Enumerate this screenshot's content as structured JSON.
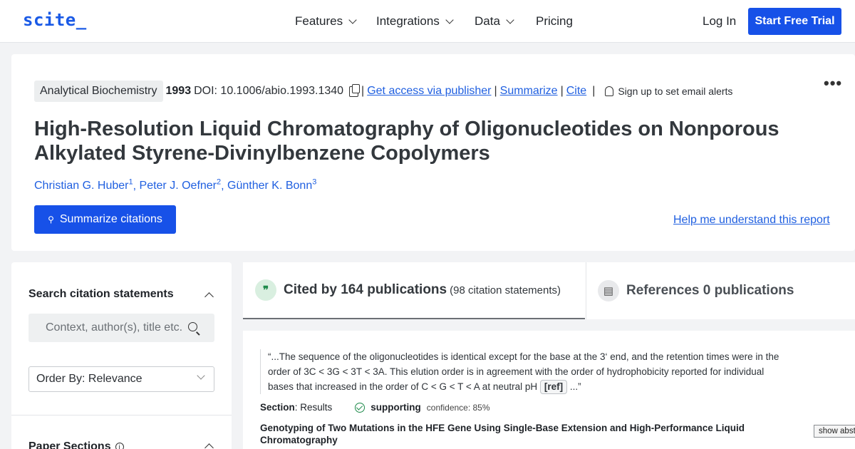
{
  "nav": {
    "logo": "scite_",
    "items": [
      {
        "label": "Features",
        "dropdown": true
      },
      {
        "label": "Integrations",
        "dropdown": true
      },
      {
        "label": "Data",
        "dropdown": true
      },
      {
        "label": "Pricing",
        "dropdown": false
      }
    ],
    "login": "Log In",
    "trial": "Start Free Trial"
  },
  "paper": {
    "journal": "Analytical Biochemistry",
    "year": "1993",
    "doi": "DOI: 10.1006/abio.1993.1340",
    "links": {
      "access": "Get access via publisher",
      "summarize": "Summarize",
      "cite": "Cite"
    },
    "alerts": "Sign up to set email alerts",
    "title": "High-Resolution Liquid Chromatography of Oligonucleotides on Nonporous Alkylated Styrene-Divinylbenzene Copolymers",
    "authors": [
      {
        "name": "Christian G. Huber",
        "sup": "1"
      },
      {
        "name": "Peter J. Oefner",
        "sup": "2"
      },
      {
        "name": "Günther K. Bonn",
        "sup": "3"
      }
    ],
    "summarize_button": "Summarize citations",
    "help_link": "Help me understand this report"
  },
  "sidebar": {
    "search_title": "Search citation statements",
    "search_placeholder": "Context, author(s), title etc.",
    "order_by": "Order By: Relevance",
    "sections_title": "Paper Sections"
  },
  "tabs": {
    "cited_main": "Cited by 164 publications",
    "cited_sub": "(98 citation statements)",
    "refs_main": "References 0 publications"
  },
  "result": {
    "quote_before": "“...The sequence of the oligonucleotides is identical except for the base at the 3‘ end, and the retention times were in the order of 3C < 3G < 3T < 3A. This elution order is in agreement with the order of hydrophobicity reported for individual bases that increased in the order of C < G < T < A at neutral pH ",
    "ref_tag": "[ref]",
    "quote_after": " ...”",
    "section_label": "Section",
    "section_value": ": Results",
    "classification": "supporting",
    "confidence": "confidence: 85%",
    "citing_title": "Genotyping of Two Mutations in the HFE Gene Using Single-Base Extension and High-Performance Liquid Chromatography",
    "show_abstract": "show abstract"
  },
  "colors": {
    "brand": "#1751e8",
    "link": "#1f5fe0",
    "supporting": "#1d8a4a"
  }
}
